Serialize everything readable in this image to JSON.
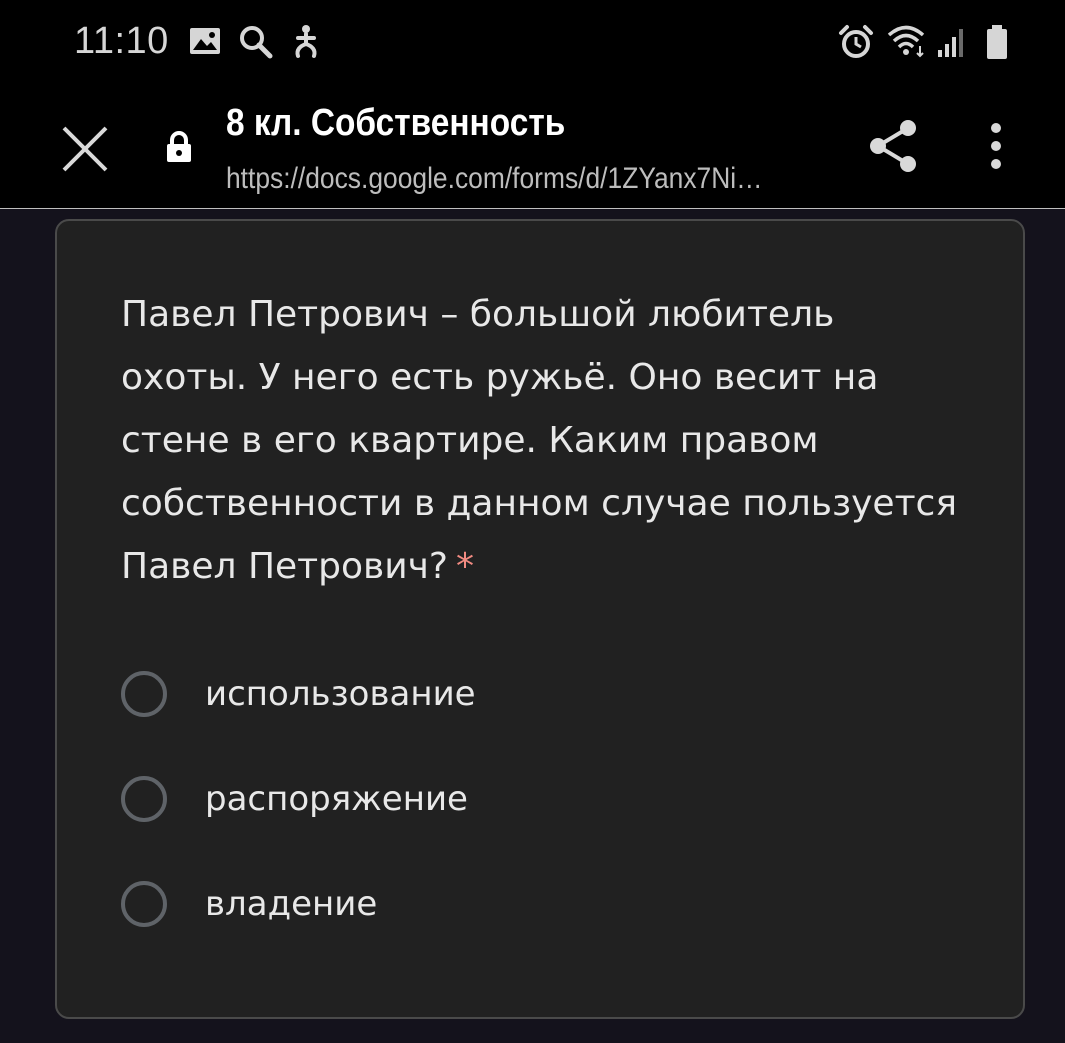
{
  "status_bar": {
    "time": "11:10",
    "left_icons": [
      "image-icon",
      "search-icon",
      "accessibility-icon"
    ],
    "right_icons": [
      "alarm-icon",
      "wifi-icon",
      "signal-icon",
      "battery-icon"
    ]
  },
  "toolbar": {
    "title": "8 кл. Собственность",
    "url": "https://docs.google.com/forms/d/1ZYanx7Ni…"
  },
  "form": {
    "question": "Павел Петрович – большой любитель охоты. У него есть ружьё. Оно весит на стене в его квартире. Каким правом собственности в данном случае пользуется Павел Петрович?",
    "required_mark": "*",
    "options": [
      {
        "label": "использование"
      },
      {
        "label": "распоряжение"
      },
      {
        "label": "владение"
      }
    ]
  },
  "colors": {
    "background": "#14121c",
    "card": "#212121",
    "required": "#f28b82"
  }
}
